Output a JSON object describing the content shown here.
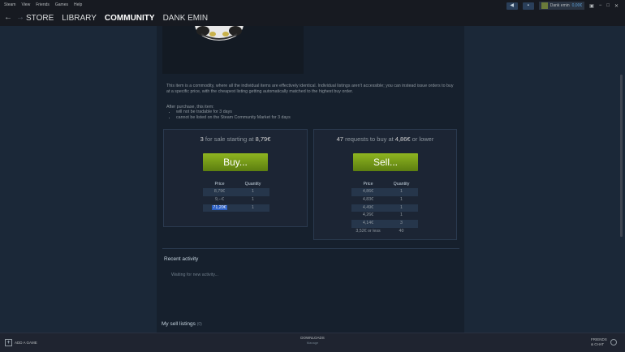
{
  "menu": {
    "items": [
      "Steam",
      "View",
      "Friends",
      "Games",
      "Help"
    ]
  },
  "header": {
    "username": "Dank emin",
    "wallet": "0,00€"
  },
  "nav": {
    "back": "←",
    "forward": "→",
    "tabs": [
      "STORE",
      "LIBRARY",
      "COMMUNITY",
      "DANK EMIN"
    ],
    "active_tab": "COMMUNITY"
  },
  "item": {
    "description": "This item is a commodity, where all the individual items are effectively identical. Individual listings aren't accessible; you can instead issue orders to buy at a specific price, with the cheapest listing getting automatically matched to the highest buy order.",
    "after_purchase_label": "After purchase, this item:",
    "restrictions": [
      "will not be tradable for 3 days",
      "cannot be listed on the Steam Community Market for 3 days"
    ]
  },
  "sell_panel": {
    "count": "3",
    "text_mid": "for sale starting at",
    "price": "8,79€",
    "button": "Buy...",
    "header_price": "Price",
    "header_qty": "Quantity",
    "rows": [
      {
        "price": "8,79€",
        "qty": "1"
      },
      {
        "price": "9,--€",
        "qty": "1"
      },
      {
        "price": "71,20€",
        "qty": "1"
      }
    ]
  },
  "buy_panel": {
    "count": "47",
    "text_mid": "requests to buy at",
    "price": "4,86€",
    "text_end": "or lower",
    "button": "Sell...",
    "header_price": "Price",
    "header_qty": "Quantity",
    "rows": [
      {
        "price": "4,86€",
        "qty": "1"
      },
      {
        "price": "4,83€",
        "qty": "1"
      },
      {
        "price": "4,49€",
        "qty": "1"
      },
      {
        "price": "4,26€",
        "qty": "1"
      },
      {
        "price": "4,14€",
        "qty": "3"
      },
      {
        "price": "3,52€ or less",
        "qty": "40"
      }
    ]
  },
  "recent": {
    "title": "Recent activity",
    "waiting": "Waiting for new activity..."
  },
  "my_listings": {
    "title": "My sell listings",
    "count": "(0)"
  },
  "bottom": {
    "add_game": "ADD A GAME",
    "downloads": "DOWNLOADS",
    "downloads_sub": "Manage",
    "friends": "FRIENDS",
    "chat": "& CHAT"
  }
}
